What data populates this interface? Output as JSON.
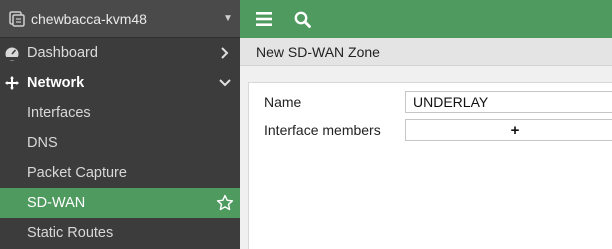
{
  "device": {
    "name": "chewbacca-kvm48"
  },
  "sidebar": {
    "items": [
      {
        "label": "Dashboard"
      },
      {
        "label": "Network"
      },
      {
        "label": "Interfaces"
      },
      {
        "label": "DNS"
      },
      {
        "label": "Packet Capture"
      },
      {
        "label": "SD-WAN"
      },
      {
        "label": "Static Routes"
      }
    ]
  },
  "page": {
    "title": "New SD-WAN Zone"
  },
  "form": {
    "name_label": "Name",
    "name_value": "UNDERLAY",
    "members_label": "Interface members",
    "add_symbol": "+"
  },
  "colors": {
    "accent": "#4f9a5f",
    "sidebar": "#3c3c3c"
  }
}
